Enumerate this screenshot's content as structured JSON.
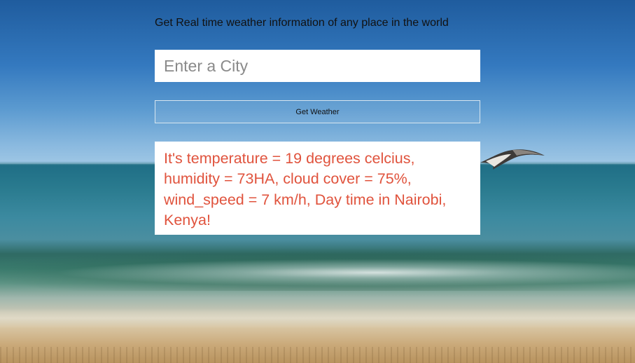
{
  "header": {
    "tagline": "Get Real time weather information of any place in the world"
  },
  "search": {
    "placeholder": "Enter a City",
    "value": ""
  },
  "actions": {
    "get_weather_label": "Get Weather"
  },
  "result": {
    "text": "It's temperature = 19 degrees celcius, humidity = 73HA, cloud cover = 75%, wind_speed = 7 km/h, Day time in Nairobi, Kenya!"
  },
  "colors": {
    "result_text": "#e0533d",
    "panel_bg": "#ffffff",
    "button_border": "#d8e6ef"
  },
  "background": {
    "scene": "beach-ocean-seagull"
  }
}
